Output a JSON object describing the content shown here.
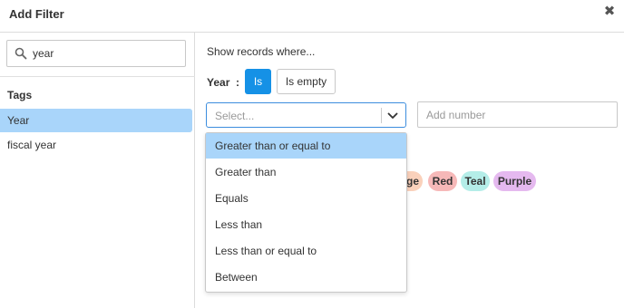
{
  "dialog": {
    "title": "Add Filter",
    "close_icon": "close-icon"
  },
  "sidebar": {
    "search": {
      "value": "year",
      "icon": "search-icon"
    },
    "tags_heading": "Tags",
    "items": [
      {
        "label": "Year",
        "selected": true
      },
      {
        "label": "fiscal year",
        "selected": false
      }
    ]
  },
  "main": {
    "show_records_label": "Show records where...",
    "field_label": "Year",
    "field_colon": ":",
    "buttons": {
      "is_label": "Is",
      "is_empty_label": "Is empty",
      "active": "Is"
    },
    "operator_select": {
      "placeholder": "Select...",
      "icon": "chevron-down-icon",
      "open": true,
      "options": [
        "Greater than or equal to",
        "Greater than",
        "Equals",
        "Less than",
        "Less than or equal to",
        "Between"
      ],
      "highlighted_option": "Greater than or equal to"
    },
    "number_input": {
      "placeholder": "Add number",
      "value": ""
    },
    "color_pills": [
      {
        "label": "ge",
        "color": "#fad1bb"
      },
      {
        "label": "Red",
        "color": "#f6b8b8"
      },
      {
        "label": "Teal",
        "color": "#b4ede8"
      },
      {
        "label": "Purple",
        "color": "#e5b9ef"
      }
    ]
  },
  "colors": {
    "accent": "#1591e6",
    "selection": "#a9d5fa",
    "focus_border": "#3c8dde"
  }
}
